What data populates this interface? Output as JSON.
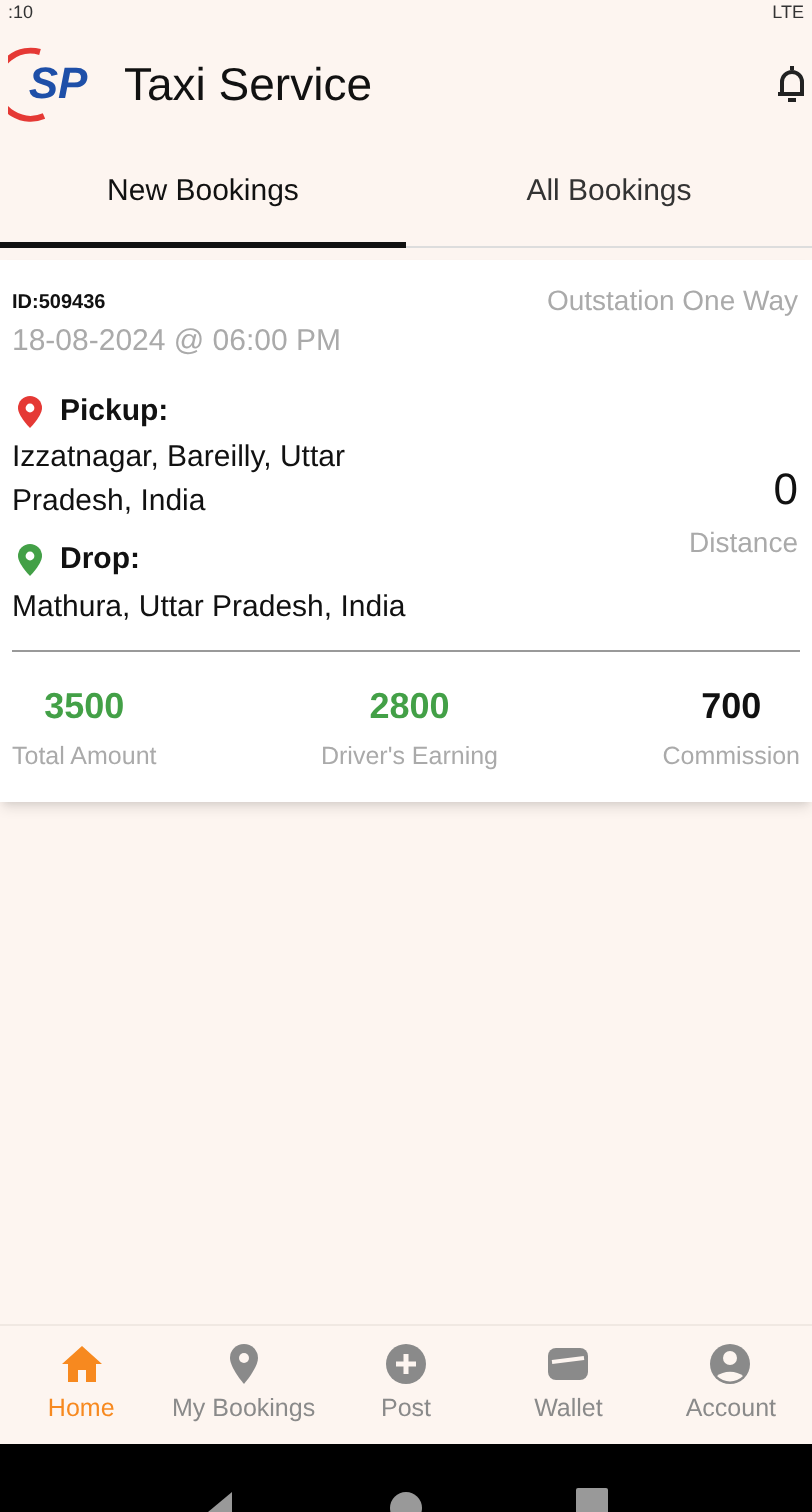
{
  "status_bar": {
    "time": ":10",
    "network": "LTE"
  },
  "app_bar": {
    "logo_text": "SP",
    "title": "Taxi Service"
  },
  "tabs": [
    {
      "label": "New Bookings",
      "selected": true
    },
    {
      "label": "All Bookings",
      "selected": false
    }
  ],
  "bookings": [
    {
      "id": "ID:509436",
      "trip_type": "Outstation One Way",
      "datetime": "18-08-2024 @ 06:00 PM",
      "pickup_label": "Pickup:",
      "pickup": "Izzatnagar, Bareilly, Uttar Pradesh, India",
      "drop_label": "Drop:",
      "drop": "Mathura, Uttar Pradesh, India",
      "distance": "0",
      "distance_label": "Distance",
      "amounts": [
        {
          "value": "3500",
          "label": "Total Amount",
          "color": "#43a047"
        },
        {
          "value": "2800",
          "label": "Driver's Earning",
          "color": "#43a047"
        },
        {
          "value": "700",
          "label": "Commission",
          "color": "#111111"
        }
      ]
    }
  ],
  "bottom_nav": [
    {
      "label": "Home",
      "kind": "home",
      "selected": true
    },
    {
      "label": "My Bookings",
      "kind": "pin",
      "selected": false
    },
    {
      "label": "Post",
      "kind": "plus",
      "selected": false
    },
    {
      "label": "Wallet",
      "kind": "wallet",
      "selected": false
    },
    {
      "label": "Account",
      "kind": "account",
      "selected": false
    }
  ]
}
